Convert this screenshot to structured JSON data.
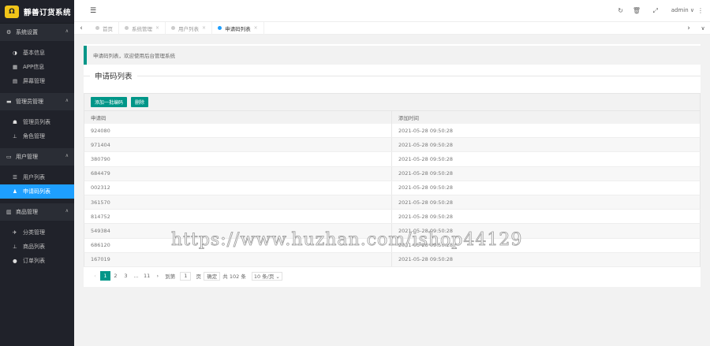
{
  "app": {
    "logo_mark": "Ω",
    "title": "靜善订货系统"
  },
  "sidebar": {
    "groups": [
      {
        "icon": "⚙",
        "title": "系统设置",
        "items": [
          {
            "icon": "◑",
            "label": "基本信息"
          },
          {
            "icon": "▦",
            "label": "APP信息"
          },
          {
            "icon": "▤",
            "label": "屏幕管理"
          }
        ]
      },
      {
        "icon": "▬",
        "title": "管理员管理",
        "items": [
          {
            "icon": "☗",
            "label": "管理员列表"
          },
          {
            "icon": "⊥",
            "label": "角色管理"
          }
        ]
      },
      {
        "icon": "▭",
        "title": "用户管理",
        "items": [
          {
            "icon": "☰",
            "label": "用户列表"
          },
          {
            "icon": "♟",
            "label": "申请码列表",
            "active": true
          }
        ]
      },
      {
        "icon": "▥",
        "title": "商品管理",
        "items": [
          {
            "icon": "✈",
            "label": "分类管理"
          },
          {
            "icon": "⊥",
            "label": "商品列表"
          },
          {
            "icon": "●",
            "label": "订单列表"
          }
        ]
      }
    ]
  },
  "topbar": {
    "menu_icon": "☰",
    "refresh_icon": "↻",
    "trash_icon": "🗑",
    "expand_icon": "⤢",
    "user": "admin ∨",
    "more_icon": "⋮"
  },
  "tabs": {
    "prev": "‹",
    "next": "›",
    "down": "∨",
    "items": [
      {
        "label": "首页",
        "active": false
      },
      {
        "label": "系统管理",
        "active": false
      },
      {
        "label": "用户列表",
        "active": false
      },
      {
        "label": "申请码列表",
        "active": true
      }
    ],
    "close": "×"
  },
  "main": {
    "notice": "申请码列表，欢迎使用后台管理系统",
    "section_title": "申请码列表",
    "toolbar": {
      "add_label": "添加一批编码",
      "delete_label": "删除"
    },
    "columns": [
      "申请码",
      "添加时间"
    ],
    "rows": [
      [
        "924080",
        "2021-05-28 09:50:28"
      ],
      [
        "971404",
        "2021-05-28 09:50:28"
      ],
      [
        "380790",
        "2021-05-28 09:50:28"
      ],
      [
        "684479",
        "2021-05-28 09:50:28"
      ],
      [
        "002312",
        "2021-05-28 09:50:28"
      ],
      [
        "361570",
        "2021-05-28 09:50:28"
      ],
      [
        "814752",
        "2021-05-28 09:50:28"
      ],
      [
        "549384",
        "2021-05-28 09:50:28"
      ],
      [
        "686120",
        "2021-05-28 09:50:28"
      ],
      [
        "167019",
        "2021-05-28 09:50:28"
      ]
    ],
    "pager": {
      "prev": "‹",
      "pages": [
        "1",
        "2",
        "3",
        "…",
        "11"
      ],
      "current": "1",
      "next": "›",
      "goto_label": "到第",
      "goto_value": "1",
      "page_unit": "页",
      "confirm": "确定",
      "total": "共 102 条",
      "page_size": "10 条/页 ⌄"
    }
  },
  "watermark": "https://www.huzhan.com/ishop44129"
}
